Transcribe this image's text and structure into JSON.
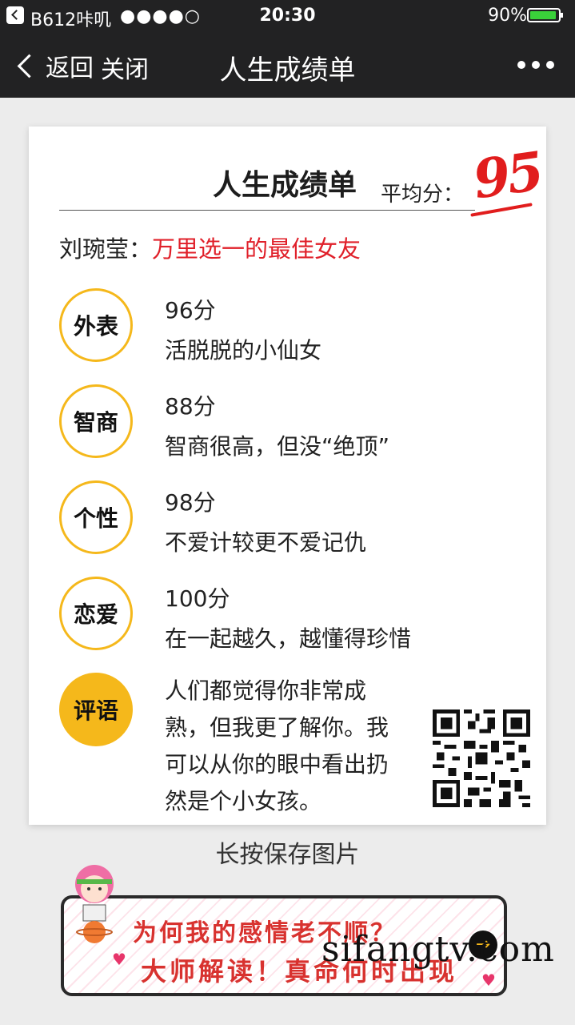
{
  "status": {
    "carrier": "B612咔叽",
    "signal_dots": "●●●●○",
    "time": "20:30",
    "battery": "90%"
  },
  "nav": {
    "back_label": "返回",
    "close_label": "关闭",
    "title": "人生成绩单"
  },
  "card": {
    "title": "人生成绩单",
    "average_label": "平均分：",
    "average_score": "95",
    "name": "刘琬莹：",
    "verdict": "万里选一的最佳女友",
    "items": [
      {
        "badge": "外表",
        "score": "96分",
        "desc": "活脱脱的小仙女"
      },
      {
        "badge": "智商",
        "score": "88分",
        "desc": "智商很高，但没“绝顶”"
      },
      {
        "badge": "个性",
        "score": "98分",
        "desc": "不爱计较更不爱记仇"
      },
      {
        "badge": "恋爱",
        "score": "100分",
        "desc": "在一起越久，越懂得珍惜"
      }
    ],
    "comment_badge": "评语",
    "comment_text": "人们都觉得你非常成熟，但我更了解你。我可以从你的眼中看出扔然是个小女孩。"
  },
  "save_hint": "长按保存图片",
  "banner": {
    "line1": "为何我的感情老不顺？",
    "line2": "大师解读！真命何时出现"
  },
  "watermark": "sifangtv.com",
  "colors": {
    "accent_yellow": "#f5b81b",
    "accent_red": "#e11d1d",
    "nav_bg": "#222223"
  }
}
